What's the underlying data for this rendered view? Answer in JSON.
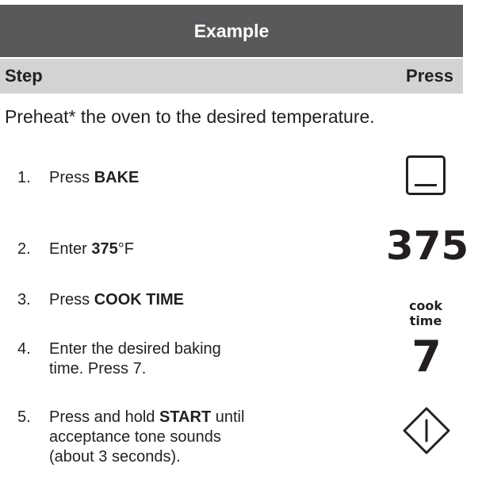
{
  "header": {
    "title": "Example"
  },
  "columns": {
    "step": "Step",
    "press": "Press"
  },
  "intro": "Preheat* the oven to the desired temperature.",
  "steps": [
    {
      "num": "1.",
      "pre": "Press ",
      "bold": "BAKE",
      "post": ""
    },
    {
      "num": "2.",
      "pre": "Enter ",
      "bold": "375",
      "post": "°F"
    },
    {
      "num": "3.",
      "pre": "Press ",
      "bold": "COOK TIME",
      "post": ""
    },
    {
      "num": "4.",
      "line1": "Enter the desired baking",
      "line2": "time. Press 7."
    },
    {
      "num": "5.",
      "pre": "Press and hold ",
      "bold": "START",
      "post": " until",
      "line2": "acceptance tone sounds",
      "line3": "(about 3 seconds)."
    }
  ],
  "press": {
    "bake_icon": "bake-key-icon",
    "temp_display": "375",
    "cook_time_line1": "cook",
    "cook_time_line2": "time",
    "time_display": "7",
    "start_icon": "start-key-icon"
  },
  "colors": {
    "header_bg": "#58595b",
    "column_bg": "#d1d3d4",
    "text": "#231f20"
  }
}
